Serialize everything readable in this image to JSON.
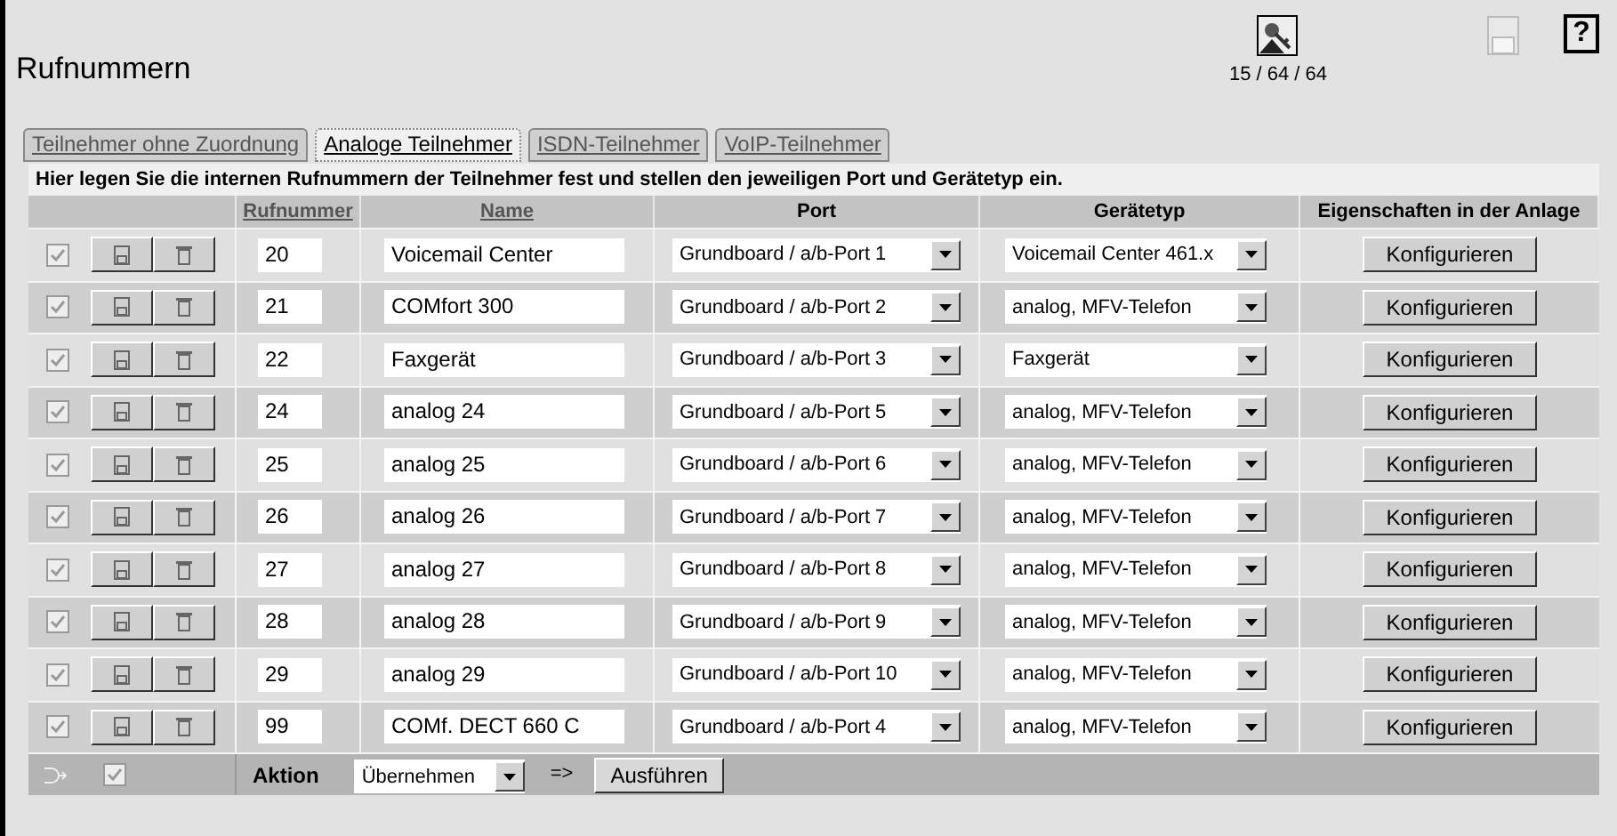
{
  "title": "Rufnummern",
  "counter": "15 / 64 / 64",
  "help": "?",
  "tabs": [
    {
      "label": "Teilnehmer ohne Zuordnung",
      "selected": false
    },
    {
      "label": "Analoge Teilnehmer",
      "selected": true
    },
    {
      "label": "ISDN-Teilnehmer",
      "selected": false
    },
    {
      "label": "VoIP-Teilnehmer",
      "selected": false
    }
  ],
  "intro": "Hier legen Sie die internen Rufnummern der Teilnehmer fest und stellen den jeweiligen Port und Gerätetyp ein.",
  "columns": [
    {
      "label": "Rufnummer",
      "sortable": true
    },
    {
      "label": "Name",
      "sortable": true
    },
    {
      "label": "Port",
      "sortable": false
    },
    {
      "label": "Gerätetyp",
      "sortable": false
    },
    {
      "label": "Eigenschaften in der Anlage",
      "sortable": false
    }
  ],
  "rows": [
    {
      "checked": true,
      "number": "20",
      "name": "Voicemail Center",
      "port": "Grundboard / a/b-Port 1",
      "device": "Voicemail Center 461.x",
      "action": "Konfigurieren"
    },
    {
      "checked": true,
      "number": "21",
      "name": "COMfort 300",
      "port": "Grundboard / a/b-Port 2",
      "device": "analog, MFV-Telefon",
      "action": "Konfigurieren"
    },
    {
      "checked": true,
      "number": "22",
      "name": "Faxgerät",
      "port": "Grundboard / a/b-Port 3",
      "device": "Faxgerät",
      "action": "Konfigurieren"
    },
    {
      "checked": true,
      "number": "24",
      "name": "analog 24",
      "port": "Grundboard / a/b-Port 5",
      "device": "analog, MFV-Telefon",
      "action": "Konfigurieren"
    },
    {
      "checked": true,
      "number": "25",
      "name": "analog 25",
      "port": "Grundboard / a/b-Port 6",
      "device": "analog, MFV-Telefon",
      "action": "Konfigurieren"
    },
    {
      "checked": true,
      "number": "26",
      "name": "analog 26",
      "port": "Grundboard / a/b-Port 7",
      "device": "analog, MFV-Telefon",
      "action": "Konfigurieren"
    },
    {
      "checked": true,
      "number": "27",
      "name": "analog 27",
      "port": "Grundboard / a/b-Port 8",
      "device": "analog, MFV-Telefon",
      "action": "Konfigurieren"
    },
    {
      "checked": true,
      "number": "28",
      "name": "analog 28",
      "port": "Grundboard / a/b-Port 9",
      "device": "analog, MFV-Telefon",
      "action": "Konfigurieren"
    },
    {
      "checked": true,
      "number": "29",
      "name": "analog 29",
      "port": "Grundboard / a/b-Port 10",
      "device": "analog, MFV-Telefon",
      "action": "Konfigurieren"
    },
    {
      "checked": true,
      "number": "99",
      "name": "COMf. DECT 660 C",
      "port": "Grundboard / a/b-Port 4",
      "device": "analog, MFV-Telefon",
      "action": "Konfigurieren"
    }
  ],
  "footer": {
    "select_all": true,
    "label": "Aktion",
    "action": "Übernehmen",
    "arrow": "=>",
    "button": "Ausführen"
  }
}
